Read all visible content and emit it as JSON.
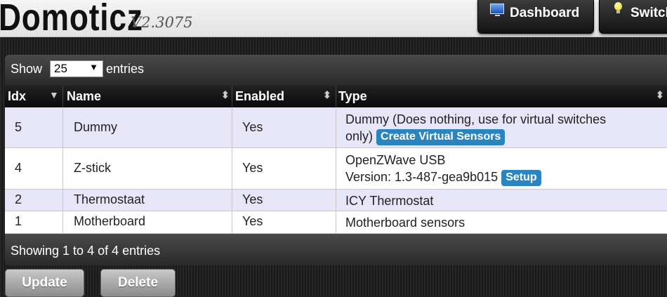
{
  "header": {
    "logo": "Domoticz",
    "version": "V2.3075",
    "nav": [
      {
        "label": "Dashboard",
        "icon": "monitor-icon"
      },
      {
        "label": "Switches",
        "icon": "lightbulb-icon"
      }
    ]
  },
  "table_controls": {
    "show_label": "Show",
    "page_size": "25",
    "entries_label": "entries",
    "info": "Showing 1 to 4 of 4 entries"
  },
  "table": {
    "columns": [
      "Idx",
      "Name",
      "Enabled",
      "Type"
    ],
    "rows": [
      {
        "idx": "5",
        "name": "Dummy",
        "enabled": "Yes",
        "type_line1": "Dummy (Does nothing, use for virtual switches",
        "type_line2": "only)",
        "action": "Create Virtual Sensors"
      },
      {
        "idx": "4",
        "name": "Z-stick",
        "enabled": "Yes",
        "type_line1": "OpenZWave USB",
        "type_line2": "Version: 1.3-487-gea9b015",
        "action": "Setup"
      },
      {
        "idx": "2",
        "name": "Thermostaat",
        "enabled": "Yes",
        "type_line1": "ICY Thermostat"
      },
      {
        "idx": "1",
        "name": "Motherboard",
        "enabled": "Yes",
        "type_line1": "Motherboard sensors"
      }
    ]
  },
  "buttons": {
    "update": "Update",
    "delete": "Delete"
  },
  "colors": {
    "accent": "#2a84c0",
    "row_odd": "#e6e6f8",
    "row_even": "#ffffff"
  }
}
